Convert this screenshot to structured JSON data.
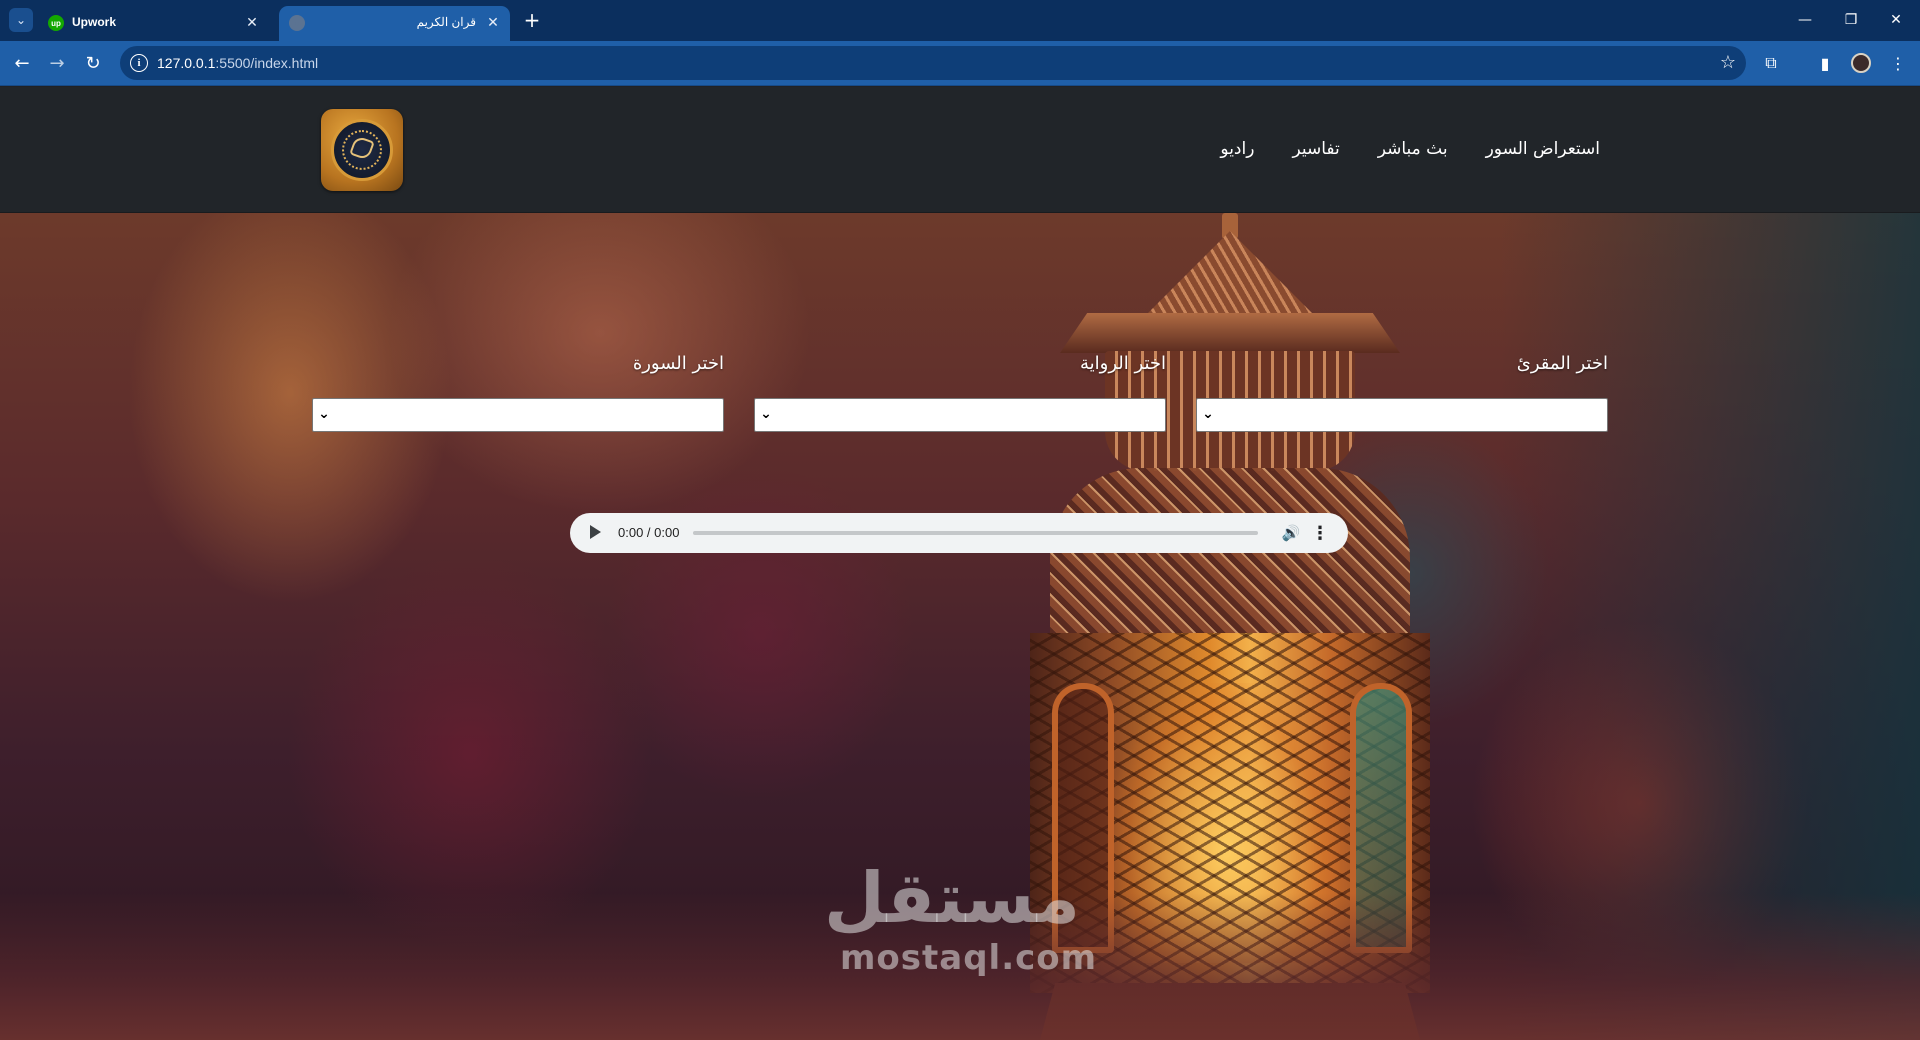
{
  "browser": {
    "tabs": [
      {
        "title": "Upwork",
        "favicon": "upwork-favicon",
        "active": false
      },
      {
        "title": "قران الكريم",
        "favicon": "globe-favicon",
        "active": true
      }
    ],
    "url": {
      "host": "127.0.0.1",
      "path": ":5500/index.html"
    },
    "icons": {
      "tab_search": "⌄",
      "close": "✕",
      "new_tab": "+",
      "minimize": "—",
      "restore": "❐",
      "window_close": "✕",
      "back": "←",
      "forward": "→",
      "reload": "↻",
      "info": "i",
      "bookmark": "☆",
      "extensions": "⧉",
      "side_panel": "▮",
      "menu": "⋮"
    }
  },
  "site": {
    "nav": [
      {
        "label": "راديو"
      },
      {
        "label": "تفاسير"
      },
      {
        "label": "بث مباشر"
      },
      {
        "label": "استعراض السور"
      }
    ],
    "form": {
      "reciter_label": "اختر المقرئ",
      "riwaya_label": "اختر الرواية",
      "surah_label": "اختر السورة",
      "reciter_value": "",
      "riwaya_value": "",
      "surah_value": ""
    },
    "player": {
      "time": "0:00 / 0:00",
      "progress": 0
    },
    "watermark": {
      "arabic": "مستقل",
      "latin": "mostaql.com"
    }
  }
}
